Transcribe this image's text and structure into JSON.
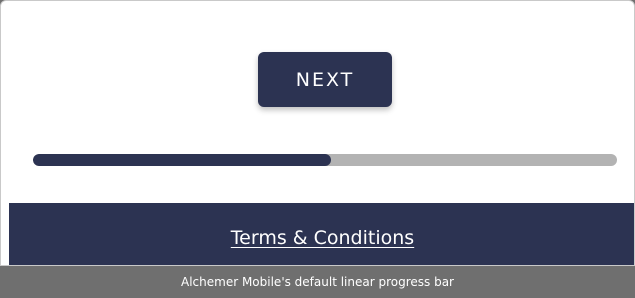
{
  "navigation": {
    "next_label": "NEXT"
  },
  "progress": {
    "value_percent": 51,
    "fill_color": "#2c3352",
    "track_color": "#b3b3b3"
  },
  "footer": {
    "terms_label": "Terms & Conditions",
    "background_color": "#2c3352"
  },
  "caption": {
    "text": "Alchemer Mobile's default linear progress bar"
  }
}
